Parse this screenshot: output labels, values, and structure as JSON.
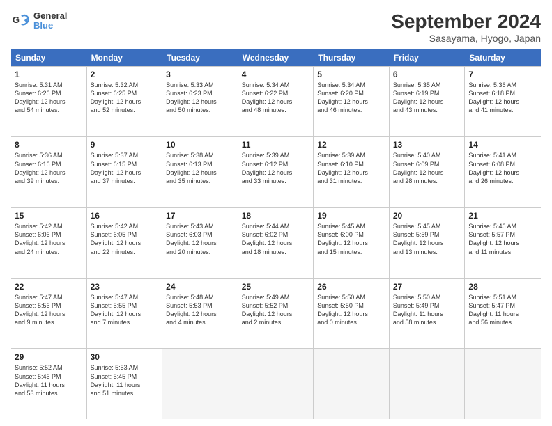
{
  "header": {
    "logo_line1": "General",
    "logo_line2": "Blue",
    "title": "September 2024",
    "subtitle": "Sasayama, Hyogo, Japan"
  },
  "calendar": {
    "days_of_week": [
      "Sunday",
      "Monday",
      "Tuesday",
      "Wednesday",
      "Thursday",
      "Friday",
      "Saturday"
    ],
    "weeks": [
      [
        {
          "day": "",
          "info": ""
        },
        {
          "day": "2",
          "info": "Sunrise: 5:32 AM\nSunset: 6:25 PM\nDaylight: 12 hours\nand 52 minutes."
        },
        {
          "day": "3",
          "info": "Sunrise: 5:33 AM\nSunset: 6:23 PM\nDaylight: 12 hours\nand 50 minutes."
        },
        {
          "day": "4",
          "info": "Sunrise: 5:34 AM\nSunset: 6:22 PM\nDaylight: 12 hours\nand 48 minutes."
        },
        {
          "day": "5",
          "info": "Sunrise: 5:34 AM\nSunset: 6:20 PM\nDaylight: 12 hours\nand 46 minutes."
        },
        {
          "day": "6",
          "info": "Sunrise: 5:35 AM\nSunset: 6:19 PM\nDaylight: 12 hours\nand 43 minutes."
        },
        {
          "day": "7",
          "info": "Sunrise: 5:36 AM\nSunset: 6:18 PM\nDaylight: 12 hours\nand 41 minutes."
        }
      ],
      [
        {
          "day": "1",
          "info": "Sunrise: 5:31 AM\nSunset: 6:26 PM\nDaylight: 12 hours\nand 54 minutes."
        },
        {
          "day": "9",
          "info": "Sunrise: 5:37 AM\nSunset: 6:15 PM\nDaylight: 12 hours\nand 37 minutes."
        },
        {
          "day": "10",
          "info": "Sunrise: 5:38 AM\nSunset: 6:13 PM\nDaylight: 12 hours\nand 35 minutes."
        },
        {
          "day": "11",
          "info": "Sunrise: 5:39 AM\nSunset: 6:12 PM\nDaylight: 12 hours\nand 33 minutes."
        },
        {
          "day": "12",
          "info": "Sunrise: 5:39 AM\nSunset: 6:10 PM\nDaylight: 12 hours\nand 31 minutes."
        },
        {
          "day": "13",
          "info": "Sunrise: 5:40 AM\nSunset: 6:09 PM\nDaylight: 12 hours\nand 28 minutes."
        },
        {
          "day": "14",
          "info": "Sunrise: 5:41 AM\nSunset: 6:08 PM\nDaylight: 12 hours\nand 26 minutes."
        }
      ],
      [
        {
          "day": "8",
          "info": "Sunrise: 5:36 AM\nSunset: 6:16 PM\nDaylight: 12 hours\nand 39 minutes."
        },
        {
          "day": "16",
          "info": "Sunrise: 5:42 AM\nSunset: 6:05 PM\nDaylight: 12 hours\nand 22 minutes."
        },
        {
          "day": "17",
          "info": "Sunrise: 5:43 AM\nSunset: 6:03 PM\nDaylight: 12 hours\nand 20 minutes."
        },
        {
          "day": "18",
          "info": "Sunrise: 5:44 AM\nSunset: 6:02 PM\nDaylight: 12 hours\nand 18 minutes."
        },
        {
          "day": "19",
          "info": "Sunrise: 5:45 AM\nSunset: 6:00 PM\nDaylight: 12 hours\nand 15 minutes."
        },
        {
          "day": "20",
          "info": "Sunrise: 5:45 AM\nSunset: 5:59 PM\nDaylight: 12 hours\nand 13 minutes."
        },
        {
          "day": "21",
          "info": "Sunrise: 5:46 AM\nSunset: 5:57 PM\nDaylight: 12 hours\nand 11 minutes."
        }
      ],
      [
        {
          "day": "15",
          "info": "Sunrise: 5:42 AM\nSunset: 6:06 PM\nDaylight: 12 hours\nand 24 minutes."
        },
        {
          "day": "23",
          "info": "Sunrise: 5:47 AM\nSunset: 5:55 PM\nDaylight: 12 hours\nand 7 minutes."
        },
        {
          "day": "24",
          "info": "Sunrise: 5:48 AM\nSunset: 5:53 PM\nDaylight: 12 hours\nand 4 minutes."
        },
        {
          "day": "25",
          "info": "Sunrise: 5:49 AM\nSunset: 5:52 PM\nDaylight: 12 hours\nand 2 minutes."
        },
        {
          "day": "26",
          "info": "Sunrise: 5:50 AM\nSunset: 5:50 PM\nDaylight: 12 hours\nand 0 minutes."
        },
        {
          "day": "27",
          "info": "Sunrise: 5:50 AM\nSunset: 5:49 PM\nDaylight: 11 hours\nand 58 minutes."
        },
        {
          "day": "28",
          "info": "Sunrise: 5:51 AM\nSunset: 5:47 PM\nDaylight: 11 hours\nand 56 minutes."
        }
      ],
      [
        {
          "day": "22",
          "info": "Sunrise: 5:47 AM\nSunset: 5:56 PM\nDaylight: 12 hours\nand 9 minutes."
        },
        {
          "day": "30",
          "info": "Sunrise: 5:53 AM\nSunset: 5:45 PM\nDaylight: 11 hours\nand 51 minutes."
        },
        {
          "day": "",
          "info": ""
        },
        {
          "day": "",
          "info": ""
        },
        {
          "day": "",
          "info": ""
        },
        {
          "day": "",
          "info": ""
        },
        {
          "day": "",
          "info": ""
        }
      ],
      [
        {
          "day": "29",
          "info": "Sunrise: 5:52 AM\nSunset: 5:46 PM\nDaylight: 11 hours\nand 53 minutes."
        },
        {
          "day": "",
          "info": ""
        },
        {
          "day": "",
          "info": ""
        },
        {
          "day": "",
          "info": ""
        },
        {
          "day": "",
          "info": ""
        },
        {
          "day": "",
          "info": ""
        },
        {
          "day": "",
          "info": ""
        }
      ]
    ]
  }
}
